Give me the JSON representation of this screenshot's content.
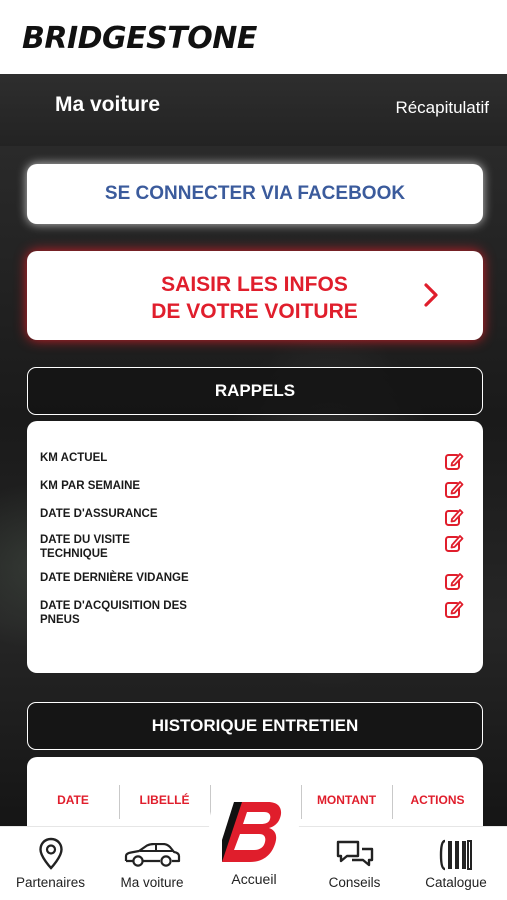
{
  "brand": {
    "name": "BRIDGESTONE"
  },
  "navbar": {
    "title": "Ma voiture",
    "right_link": "Récapitulatif"
  },
  "facebook_button": {
    "label": "SE CONNECTER VIA FACEBOOK",
    "color": "#3b5b9c"
  },
  "car_info_button": {
    "line1": "SAISIR LES INFOS",
    "line2": "DE VOTRE VOITURE",
    "color": "#e01e2c"
  },
  "rappels": {
    "title": "RAPPELS",
    "items": [
      {
        "line1": "KM ACTUEL",
        "line2": ""
      },
      {
        "line1": "KM PAR SEMAINE",
        "line2": ""
      },
      {
        "line1": "DATE D'ASSURANCE",
        "line2": ""
      },
      {
        "line1": "DATE DU VISITE",
        "line2": "TECHNIQUE"
      },
      {
        "line1": "DATE DERNIÈRE VIDANGE",
        "line2": ""
      },
      {
        "line1": "DATE D'ACQUISITION DES",
        "line2": "PNEUS"
      }
    ]
  },
  "historique": {
    "title": "HISTORIQUE ENTRETIEN",
    "columns": [
      "DATE",
      "LIBELLÉ",
      "",
      "MONTANT",
      "ACTIONS"
    ]
  },
  "tabbar": {
    "tabs": [
      {
        "label": "Partenaires",
        "icon": "location-pin-icon"
      },
      {
        "label": "Ma voiture",
        "icon": "car-icon"
      },
      {
        "label": "Accueil",
        "icon": "bridgestone-b-icon"
      },
      {
        "label": "Conseils",
        "icon": "chat-bubbles-icon"
      },
      {
        "label": "Catalogue",
        "icon": "tire-catalogue-icon"
      }
    ]
  }
}
